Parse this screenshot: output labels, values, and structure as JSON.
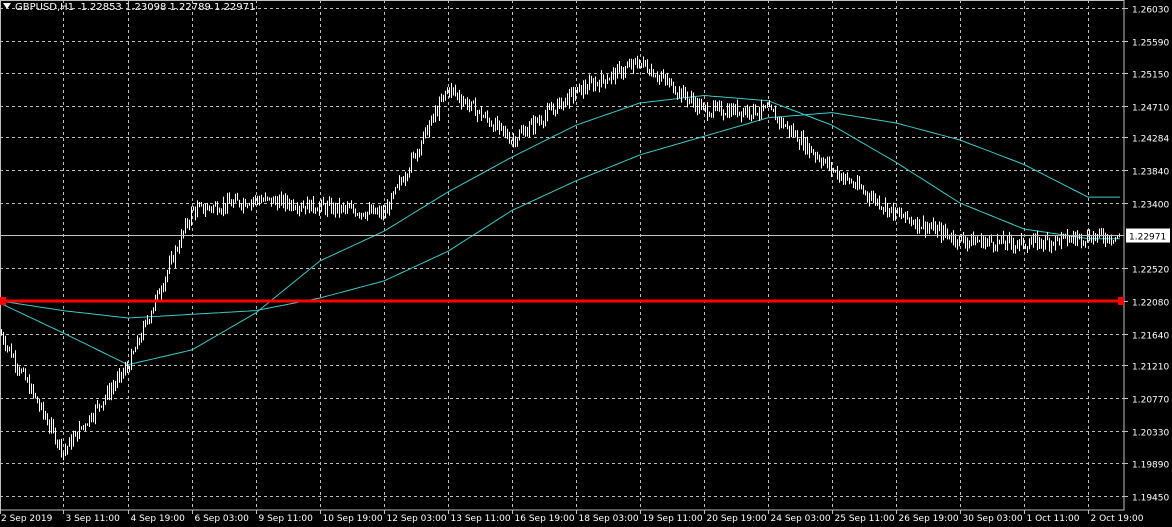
{
  "header": {
    "symbol": "GBPUSD,H1",
    "ohlc": "1.22853 1.23098 1.22789 1.22971"
  },
  "colors": {
    "background": "#000000",
    "grid": "#c0c0c0",
    "candles": "#ffffff",
    "ma": "#40c8c8",
    "hline": "#ff0000",
    "axis_text": "#ffffff"
  },
  "chart_data": {
    "type": "line",
    "instrument": "GBPUSD",
    "timeframe": "H1",
    "ylim": [
      1.1945,
      1.2603
    ],
    "grid": true,
    "y_ticks": [
      "1.26030",
      "1.25590",
      "1.25150",
      "1.24710",
      "1.24284",
      "1.23840",
      "1.23400",
      "1.22971",
      "1.22520",
      "1.22080",
      "1.21640",
      "1.21210",
      "1.20770",
      "1.20330",
      "1.19890",
      "1.19450"
    ],
    "x_ticks": [
      "2 Sep 2019",
      "3 Sep 11:00",
      "4 Sep 19:00",
      "6 Sep 03:00",
      "9 Sep 11:00",
      "10 Sep 19:00",
      "12 Sep 03:00",
      "13 Sep 11:00",
      "16 Sep 19:00",
      "18 Sep 03:00",
      "19 Sep 11:00",
      "20 Sep 19:00",
      "24 Sep 03:00",
      "25 Sep 11:00",
      "26 Sep 19:00",
      "30 Sep 03:00",
      "1 Oct 11:00",
      "2 Oct 19:00"
    ],
    "last_price": "1.22971",
    "horizontal_line": 1.2208,
    "price_series": {
      "x": [
        "2 Sep 2019",
        "3 Sep 11:00",
        "4 Sep 19:00",
        "6 Sep 03:00",
        "9 Sep 11:00",
        "10 Sep 19:00",
        "12 Sep 03:00",
        "13 Sep 11:00",
        "16 Sep 19:00",
        "18 Sep 03:00",
        "19 Sep 11:00",
        "20 Sep 19:00",
        "24 Sep 03:00",
        "25 Sep 11:00",
        "26 Sep 19:00",
        "30 Sep 03:00",
        "1 Oct 11:00",
        "2 Oct 19:00"
      ],
      "values": [
        1.2165,
        1.2005,
        1.212,
        1.233,
        1.2345,
        1.2335,
        1.2325,
        1.2495,
        1.2425,
        1.249,
        1.253,
        1.2465,
        1.2465,
        1.2385,
        1.2325,
        1.229,
        1.2285,
        1.2295
      ]
    },
    "ma_fast": {
      "x": [
        "2 Sep 2019",
        "3 Sep 11:00",
        "4 Sep 19:00",
        "6 Sep 03:00",
        "9 Sep 11:00",
        "10 Sep 19:00",
        "12 Sep 03:00",
        "13 Sep 11:00",
        "16 Sep 19:00",
        "18 Sep 03:00",
        "19 Sep 11:00",
        "20 Sep 19:00",
        "24 Sep 03:00",
        "25 Sep 11:00",
        "26 Sep 19:00",
        "30 Sep 03:00",
        "1 Oct 11:00",
        "2 Oct 19:00"
      ],
      "values": [
        1.2205,
        1.2165,
        1.2122,
        1.2142,
        1.2192,
        1.2262,
        1.2302,
        1.2355,
        1.2402,
        1.2445,
        1.2475,
        1.2485,
        1.2478,
        1.2445,
        1.2395,
        1.234,
        1.2305,
        1.2292
      ]
    },
    "ma_slow": {
      "x": [
        "2 Sep 2019",
        "3 Sep 11:00",
        "4 Sep 19:00",
        "6 Sep 03:00",
        "9 Sep 11:00",
        "10 Sep 19:00",
        "12 Sep 03:00",
        "13 Sep 11:00",
        "16 Sep 19:00",
        "18 Sep 03:00",
        "19 Sep 11:00",
        "20 Sep 19:00",
        "24 Sep 03:00",
        "25 Sep 11:00",
        "26 Sep 19:00",
        "30 Sep 03:00",
        "1 Oct 11:00",
        "2 Oct 19:00"
      ],
      "values": [
        1.2208,
        1.2195,
        1.2185,
        1.219,
        1.2195,
        1.2212,
        1.2235,
        1.2275,
        1.233,
        1.237,
        1.2405,
        1.243,
        1.2455,
        1.2462,
        1.2448,
        1.2425,
        1.2392,
        1.2348
      ]
    }
  }
}
